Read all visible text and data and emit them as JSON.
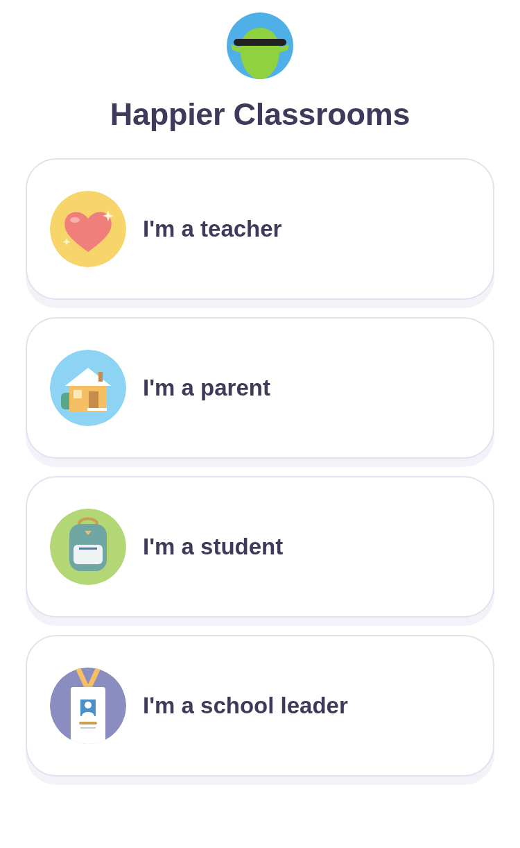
{
  "header": {
    "title": "Happier Classrooms"
  },
  "roles": [
    {
      "kind": "teacher",
      "label": "I'm a teacher"
    },
    {
      "kind": "parent",
      "label": "I'm a parent"
    },
    {
      "kind": "student",
      "label": "I'm a student"
    },
    {
      "kind": "leader",
      "label": "I'm a school leader"
    }
  ]
}
